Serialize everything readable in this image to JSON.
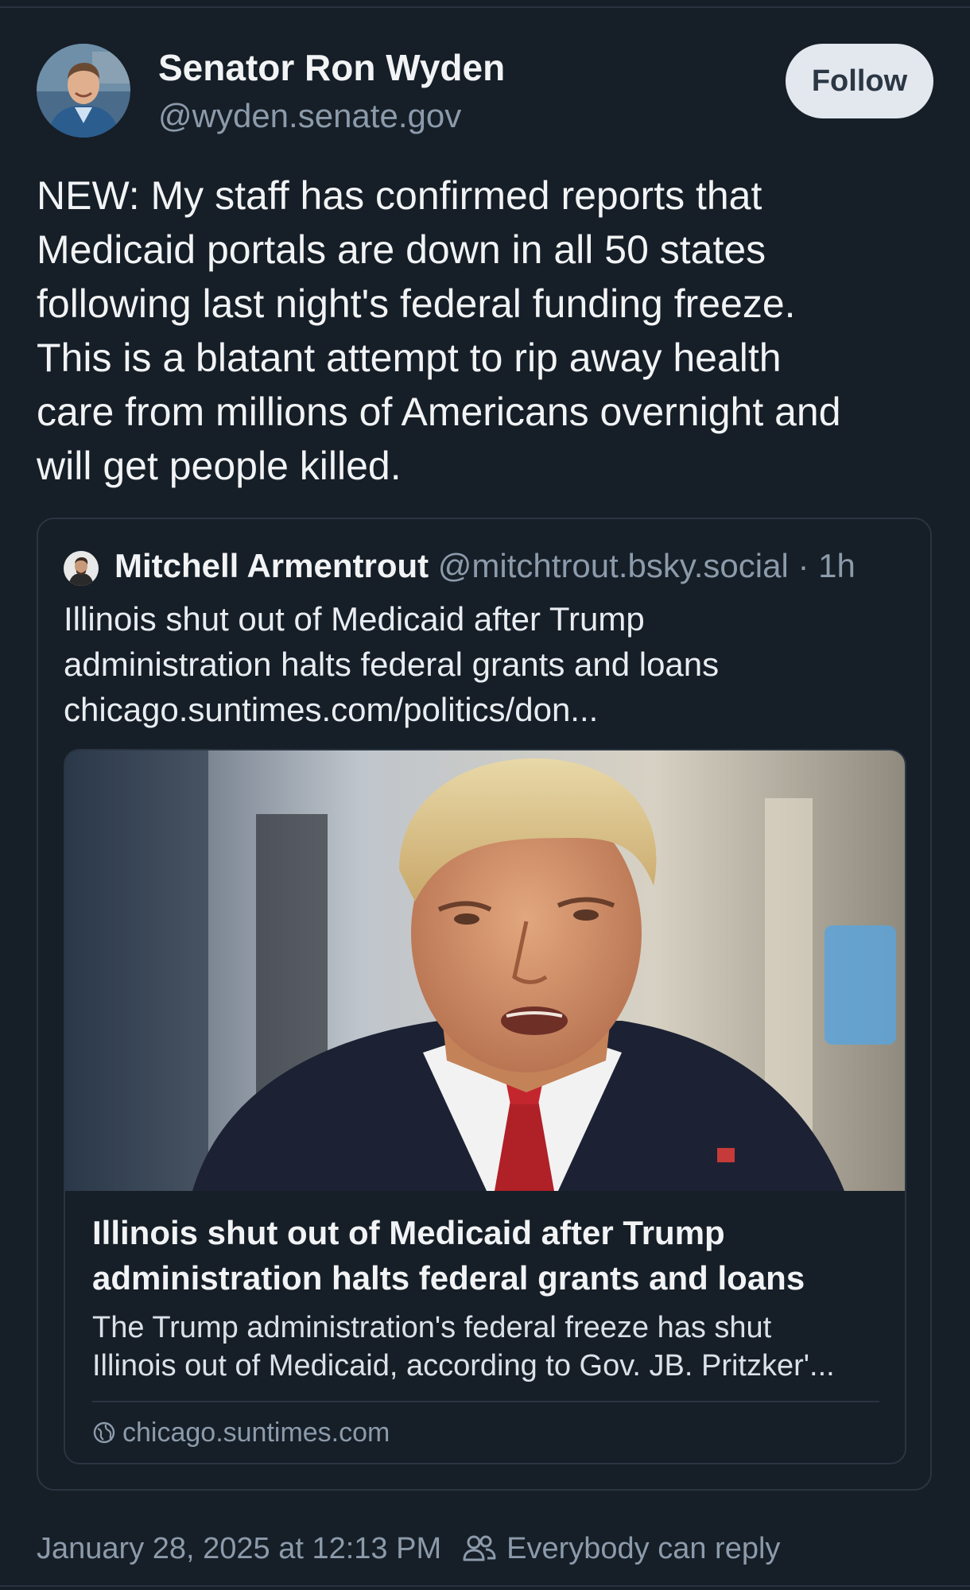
{
  "post": {
    "author": {
      "name": "Senator Ron Wyden",
      "handle": "@wyden.senate.gov"
    },
    "follow_label": "Follow",
    "text": "NEW: My staff has confirmed reports that\nMedicaid portals are down in all 50 states\nfollowing last night's federal funding freeze.\nThis is a blatant attempt to rip away health\ncare from millions of Americans overnight and\nwill get people killed.",
    "timestamp": "January 28, 2025 at 12:13 PM",
    "reply_setting": "Everybody can reply"
  },
  "quote": {
    "author_name": "Mitchell Armentrout",
    "handle": "@mitchtrout.bsky.social",
    "separator": "·",
    "time": "1h",
    "text": "Illinois shut out of Medicaid after Trump\nadministration halts federal grants and loans\nchicago.suntimes.com/politics/don...",
    "link_card": {
      "title": "Illinois shut out of Medicaid after Trump\nadministration halts federal grants and loans",
      "description": "The Trump administration's federal freeze has shut\nIllinois out of Medicaid, according to Gov. JB. Pritzker'...",
      "domain": "chicago.suntimes.com",
      "domain_icon": "globe-icon"
    }
  },
  "icons": {
    "reply_setting": "people-icon"
  },
  "colors": {
    "background": "#161e27",
    "border": "#2a3542",
    "muted_text": "#8c9bab",
    "follow_bg": "#e3e8ee"
  }
}
